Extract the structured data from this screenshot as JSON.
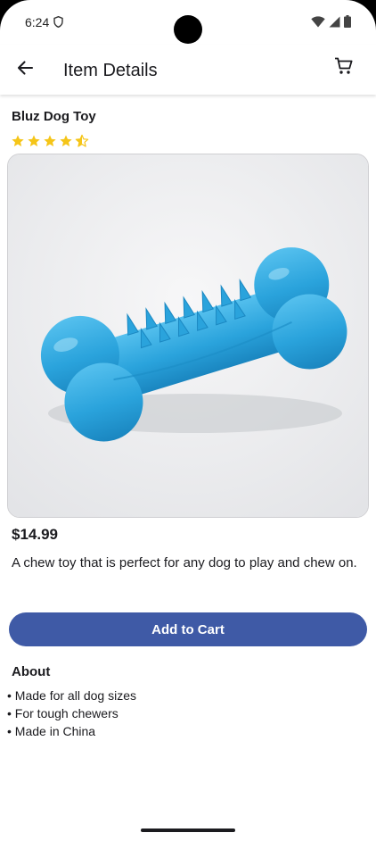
{
  "status": {
    "time": "6:24"
  },
  "appbar": {
    "title": "Item Details"
  },
  "product": {
    "name": "Bluz Dog Toy",
    "rating": 4.5,
    "rating_max": 5,
    "price": "$14.99",
    "description": "A chew toy that is perfect for any dog to play and chew on.",
    "image_icon": "blue-bone-chew-toy"
  },
  "actions": {
    "add_to_cart_label": "Add to Cart"
  },
  "about": {
    "title": "About",
    "items": [
      "Made for all dog sizes",
      "For tough chewers",
      "Made in China"
    ]
  },
  "colors": {
    "accent": "#3f5aa6",
    "star": "#f5c518",
    "toy": "#2fa7de"
  }
}
